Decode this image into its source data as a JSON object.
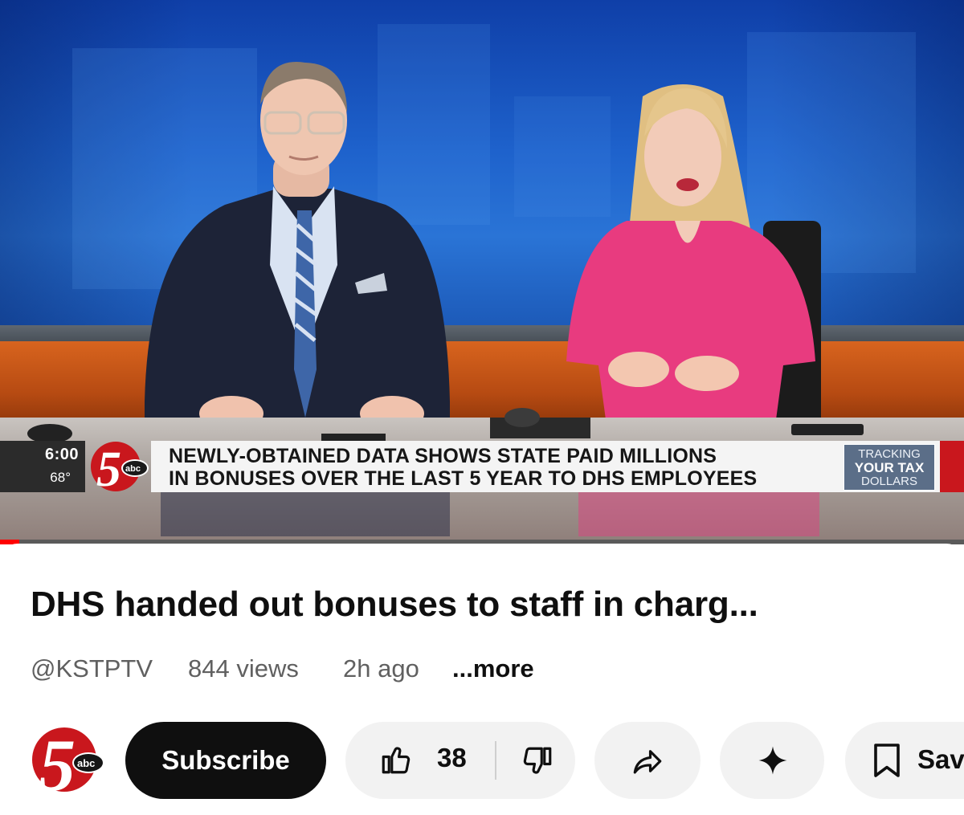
{
  "video": {
    "lower_third": {
      "time": "6:00",
      "temperature": "68°",
      "station_logo": "5 abc",
      "headline_line1": "NEWLY-OBTAINED DATA SHOWS STATE PAID MILLIONS",
      "headline_line2": "IN BONUSES OVER THE LAST 5 YEAR TO DHS EMPLOYEES",
      "segment_badge": [
        "TRACKING",
        "YOUR TAX",
        "DOLLARS"
      ]
    },
    "progress_fraction": 0.02,
    "progress_color": "#ff0000"
  },
  "info": {
    "title": "DHS handed out bonuses to staff in charg...",
    "channel": "@KSTPTV",
    "views": "844 views",
    "uploaded": "2h ago",
    "more": "...more"
  },
  "actions": {
    "subscribe": "Subscribe",
    "like_count": "38",
    "save": "Save",
    "icons": [
      "thumbs-up-icon",
      "thumbs-down-icon",
      "share-icon",
      "sparkle-icon",
      "bookmark-icon"
    ]
  },
  "colors": {
    "subscribe_bg": "#0f0f0f",
    "pill_bg": "#f2f2f2",
    "logo_red": "#c9171d"
  }
}
